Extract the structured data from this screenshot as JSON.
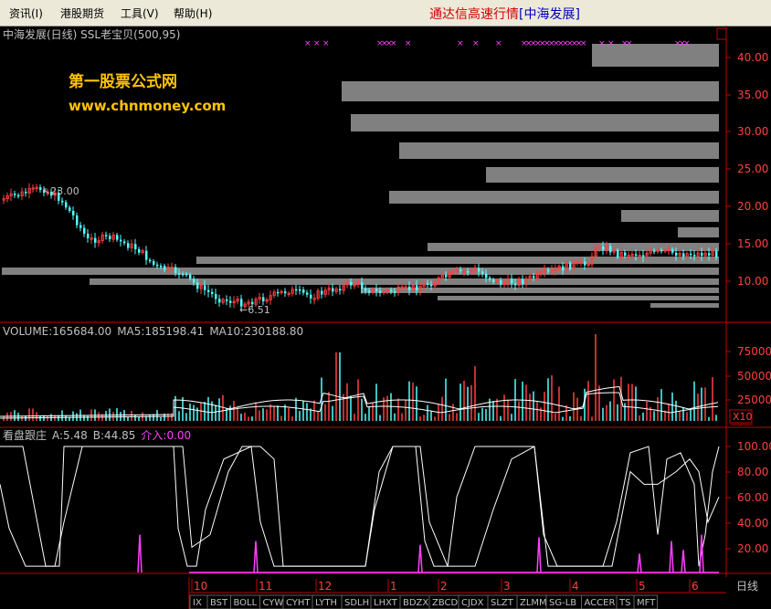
{
  "menubar": {
    "items": [
      "资讯(I)",
      "港股期货",
      "工具(V)",
      "帮助(H)"
    ],
    "title_prefix": "通达信高速行情",
    "title_stock": "[中海发展]"
  },
  "kline_panel": {
    "header": "中海发展(日线) SSL老宝贝(500,95)",
    "watermark_cn": "第一股票公式网",
    "watermark_url": "www.chnmoney.com",
    "high_label": "23.00",
    "low_label": "6.51",
    "y_ticks": [
      "40.00",
      "35.00",
      "30.00",
      "25.00",
      "20.00",
      "15.00",
      "10.00"
    ]
  },
  "volume_panel": {
    "header_volume": "VOLUME:165684.00",
    "header_ma5": "MA5:185198.41",
    "header_ma10": "MA10:230188.80",
    "y_ticks": [
      "75000",
      "50000",
      "25000"
    ],
    "unit": "X10"
  },
  "indicator_panel": {
    "header_name": "看盘跟庄",
    "header_a": "A:5.48",
    "header_b": "B:44.85",
    "header_entry": "介入:0.00",
    "y_ticks": [
      "100.00",
      "80.00",
      "60.00",
      "40.00",
      "20.00"
    ]
  },
  "time_axis": {
    "months": [
      "10",
      "11",
      "12",
      "1",
      "2",
      "3",
      "4",
      "5",
      "6"
    ],
    "period": "日线"
  },
  "indicator_tabs": [
    "IX",
    "BST",
    "BOLL",
    "CYW",
    "CYHT",
    "LYTH",
    "SDLH",
    "LHXT",
    "BDZX",
    "ZBCD",
    "CJDX",
    "SLZT",
    "ZLMM",
    "SG-LB",
    "ACCER",
    "TS",
    "MFT"
  ],
  "colors": {
    "up": "#ff4040",
    "down": "#54ffff",
    "axis": "#c00000",
    "ssl_bar": "#808080",
    "entry": "#ff00ff",
    "watermark": "#ffc400"
  }
}
